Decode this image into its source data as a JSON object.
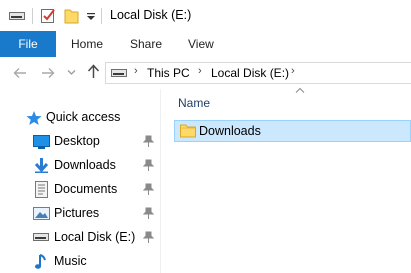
{
  "window": {
    "title": "Local Disk (E:)"
  },
  "ribbon": {
    "tabs": [
      {
        "label": "File"
      },
      {
        "label": "Home"
      },
      {
        "label": "Share"
      },
      {
        "label": "View"
      }
    ]
  },
  "address": {
    "crumbs": [
      {
        "label": "This PC"
      },
      {
        "label": "Local Disk (E:)"
      }
    ]
  },
  "nav": {
    "quick_access": "Quick access",
    "items": [
      {
        "label": "Desktop",
        "icon": "desktop-icon",
        "pinned": true
      },
      {
        "label": "Downloads",
        "icon": "downloads-icon",
        "pinned": true
      },
      {
        "label": "Documents",
        "icon": "documents-icon",
        "pinned": true
      },
      {
        "label": "Pictures",
        "icon": "pictures-icon",
        "pinned": true
      },
      {
        "label": "Local Disk (E:)",
        "icon": "drive-icon",
        "pinned": true
      },
      {
        "label": "Music",
        "icon": "music-icon",
        "pinned": false
      }
    ]
  },
  "content": {
    "column_header": "Name",
    "rows": [
      {
        "name": "Downloads",
        "icon": "folder-icon",
        "selected": true
      }
    ]
  },
  "colors": {
    "file_tab": "#1979ca",
    "selection_fill": "#cce8ff",
    "selection_border": "#99d1ff",
    "header_text": "#1e3f66"
  }
}
